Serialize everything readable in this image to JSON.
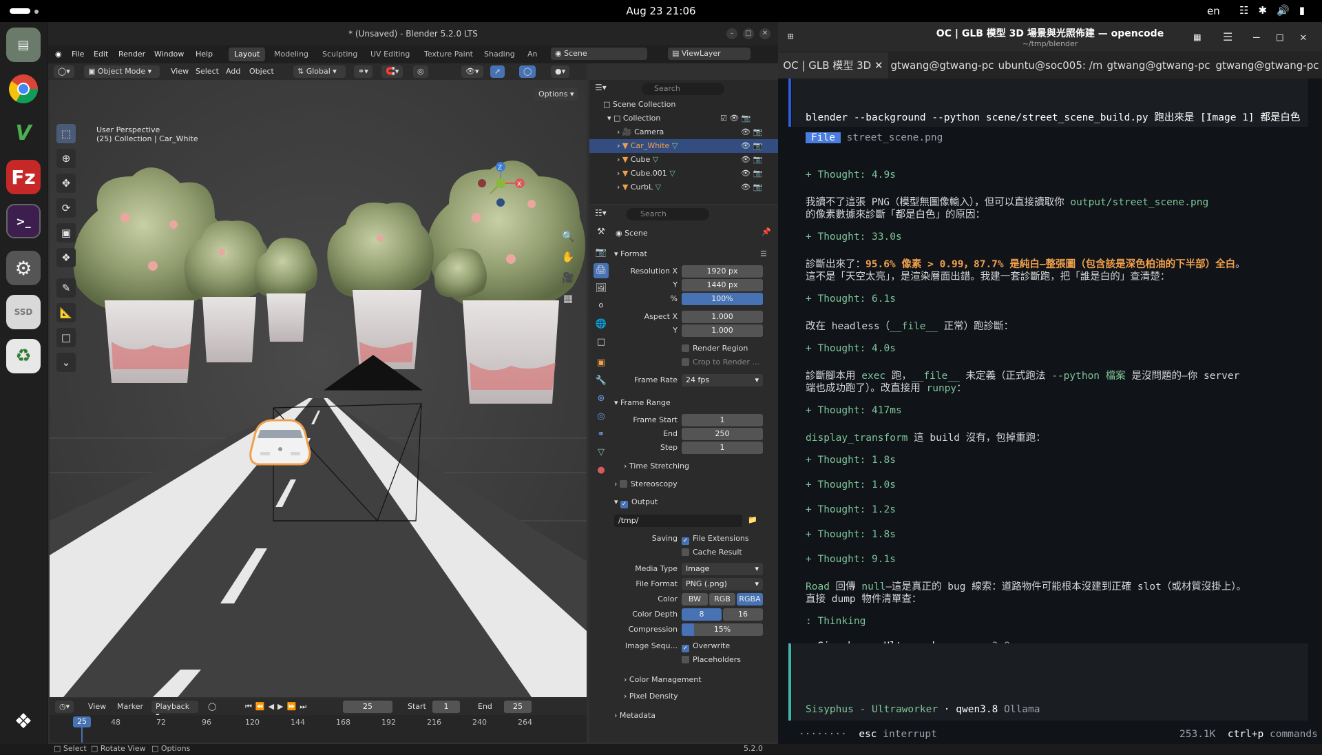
{
  "system": {
    "clock": "Aug 23  21:06",
    "lang": "en"
  },
  "dock": {
    "items": [
      "files",
      "chrome",
      "vim",
      "filezilla",
      "terminal",
      "settings",
      "ssd",
      "trash",
      "ubuntu"
    ],
    "ssd_label": "SSD"
  },
  "blender": {
    "title": "* (Unsaved) - Blender 5.2.0 LTS",
    "menu": [
      "File",
      "Edit",
      "Render",
      "Window",
      "Help"
    ],
    "workspaces": [
      "Layout",
      "Modeling",
      "Sculpting",
      "UV Editing",
      "Texture Paint",
      "Shading",
      "An"
    ],
    "scene": "Scene",
    "view_layer": "ViewLayer",
    "vp_header": {
      "mode": "Object Mode",
      "view": "View",
      "select": "Select",
      "add": "Add",
      "object": "Object",
      "orientation": "Global",
      "options": "Options"
    },
    "overlay": {
      "line1": "User Perspective",
      "line2": "(25) Collection | Car_White"
    },
    "outliner": {
      "search_placeholder": "Search",
      "scene_collection": "Scene Collection",
      "collection": "Collection",
      "items": [
        "Camera",
        "Car_White",
        "Cube",
        "Cube.001",
        "CurbL"
      ]
    },
    "properties": {
      "search_placeholder": "Search",
      "context": "Scene",
      "format_header": "Format",
      "res_x_label": "Resolution X",
      "res_x": "1920 px",
      "res_y_label": "Y",
      "res_y": "1440 px",
      "res_pct_label": "%",
      "res_pct": "100%",
      "aspect_x_label": "Aspect X",
      "aspect_x": "1.000",
      "aspect_y_label": "Y",
      "aspect_y": "1.000",
      "render_region": "Render Region",
      "crop": "Crop to Render ...",
      "frame_rate_label": "Frame Rate",
      "frame_rate": "24 fps",
      "frame_range_header": "Frame Range",
      "frame_start_label": "Frame Start",
      "frame_start": "1",
      "end_label": "End",
      "end": "250",
      "step_label": "Step",
      "step": "1",
      "time_stretching": "Time Stretching",
      "stereoscopy": "Stereoscopy",
      "output_header": "Output",
      "output_path": "/tmp/",
      "saving_label": "Saving",
      "file_extensions": "File Extensions",
      "cache_result": "Cache Result",
      "media_type_label": "Media Type",
      "media_type": "Image",
      "file_format_label": "File Format",
      "file_format": "PNG (.png)",
      "color_label": "Color",
      "color_options": [
        "BW",
        "RGB",
        "RGBA"
      ],
      "color_depth_label": "Color Depth",
      "depth_options": [
        "8",
        "16"
      ],
      "compression_label": "Compression",
      "compression": "15%",
      "compression_value": 0.15,
      "image_seq_label": "Image Sequ...",
      "overwrite": "Overwrite",
      "placeholders": "Placeholders",
      "color_management": "Color Management",
      "pixel_density": "Pixel Density",
      "metadata": "Metadata"
    },
    "timeline": {
      "view": "View",
      "marker": "Marker",
      "playback": "Playback",
      "current_frame": "25",
      "start_label": "Start",
      "start": "1",
      "end_label": "End",
      "end": "25",
      "ticks": [
        "25",
        "48",
        "72",
        "96",
        "120",
        "144",
        "168",
        "192",
        "216",
        "240",
        "264"
      ]
    },
    "status": {
      "select": "Select",
      "rotate": "Rotate View",
      "options": "Options",
      "version": "5.2.0"
    }
  },
  "terminal": {
    "title": "OC | GLB 模型 3D 場景與光照佈建 — opencode",
    "subtitle": "~/tmp/blender",
    "tabs": [
      "OC | GLB 模型 3D",
      "gtwang@gtwang-pc",
      "ubuntu@soc005: /m",
      "gtwang@gtwang-pc",
      "gtwang@gtwang-pc"
    ],
    "command": "blender --background --python scene/street_scene_build.py 跑出來是 [Image 1] 都是白色",
    "file_badge": "File",
    "file_name": "street_scene.png",
    "lines": {
      "t1": "+ Thought: 4.9s",
      "p1a": "我讀不了這張 PNG（模型無圖像輸入），但可以直接讀取你 ",
      "p1b": "output/street_scene.png",
      "p1c": "的像素數據來診斷「都是白色」的原因：",
      "t2": "+ Thought: 33.0s",
      "p2a": "診斷出來了：",
      "p2b": "95.6% 像素 > 0.99，87.7% 是純白—整張圖（包含該是深色柏油的下半部）全白",
      "p2c": "。",
      "p2d": "這不是「天空太亮」，是渲染層面出錯。我建一套診斷跑，把「誰是白的」查清楚：",
      "t3": "+ Thought: 6.1s",
      "p3a": "改在 headless（",
      "p3b": "__file__",
      "p3c": " 正常）跑診斷：",
      "t4": "+ Thought: 4.0s",
      "p4a": "診斷腳本用 ",
      "p4b": "exec",
      "p4c": " 跑，",
      "p4d": "__file__",
      "p4e": " 未定義（正式跑法 ",
      "p4f": "--python 檔案",
      "p4g": " 是沒問題的—你 server",
      "p4h": "端也成功跑了）。改直接用 ",
      "p4i": "runpy",
      "p4j": "：",
      "t5": "+ Thought: 417ms",
      "p5a": "display_transform",
      "p5b": " 這 build 沒有，包掉重跑：",
      "t6": "+ Thought: 1.8s",
      "t7": "+ Thought: 1.0s",
      "t8": "+ Thought: 1.2s",
      "t9": "+ Thought: 1.8s",
      "t10": "+ Thought: 9.1s",
      "p6a": "Road",
      "p6b": " 回傳 ",
      "p6c": "null",
      "p6d": "—這是真正的 bug 線索：道路物件可能根本沒建到正確 slot（或材質沒掛上）。",
      "p6e": "直接 dump 物件清單查：",
      "thinking": ": Thinking",
      "agent": "Sisyphus - Ultraworker",
      "model": "· qwen3.8",
      "footer_agent": "Sisyphus - Ultraworker",
      "footer_model": "· qwen3.8",
      "footer_provider": "Ollama",
      "esc": "esc",
      "interrupt": "interrupt",
      "tokens": "253.1K",
      "ctrlp": "ctrl+p",
      "commands": "commands"
    }
  }
}
